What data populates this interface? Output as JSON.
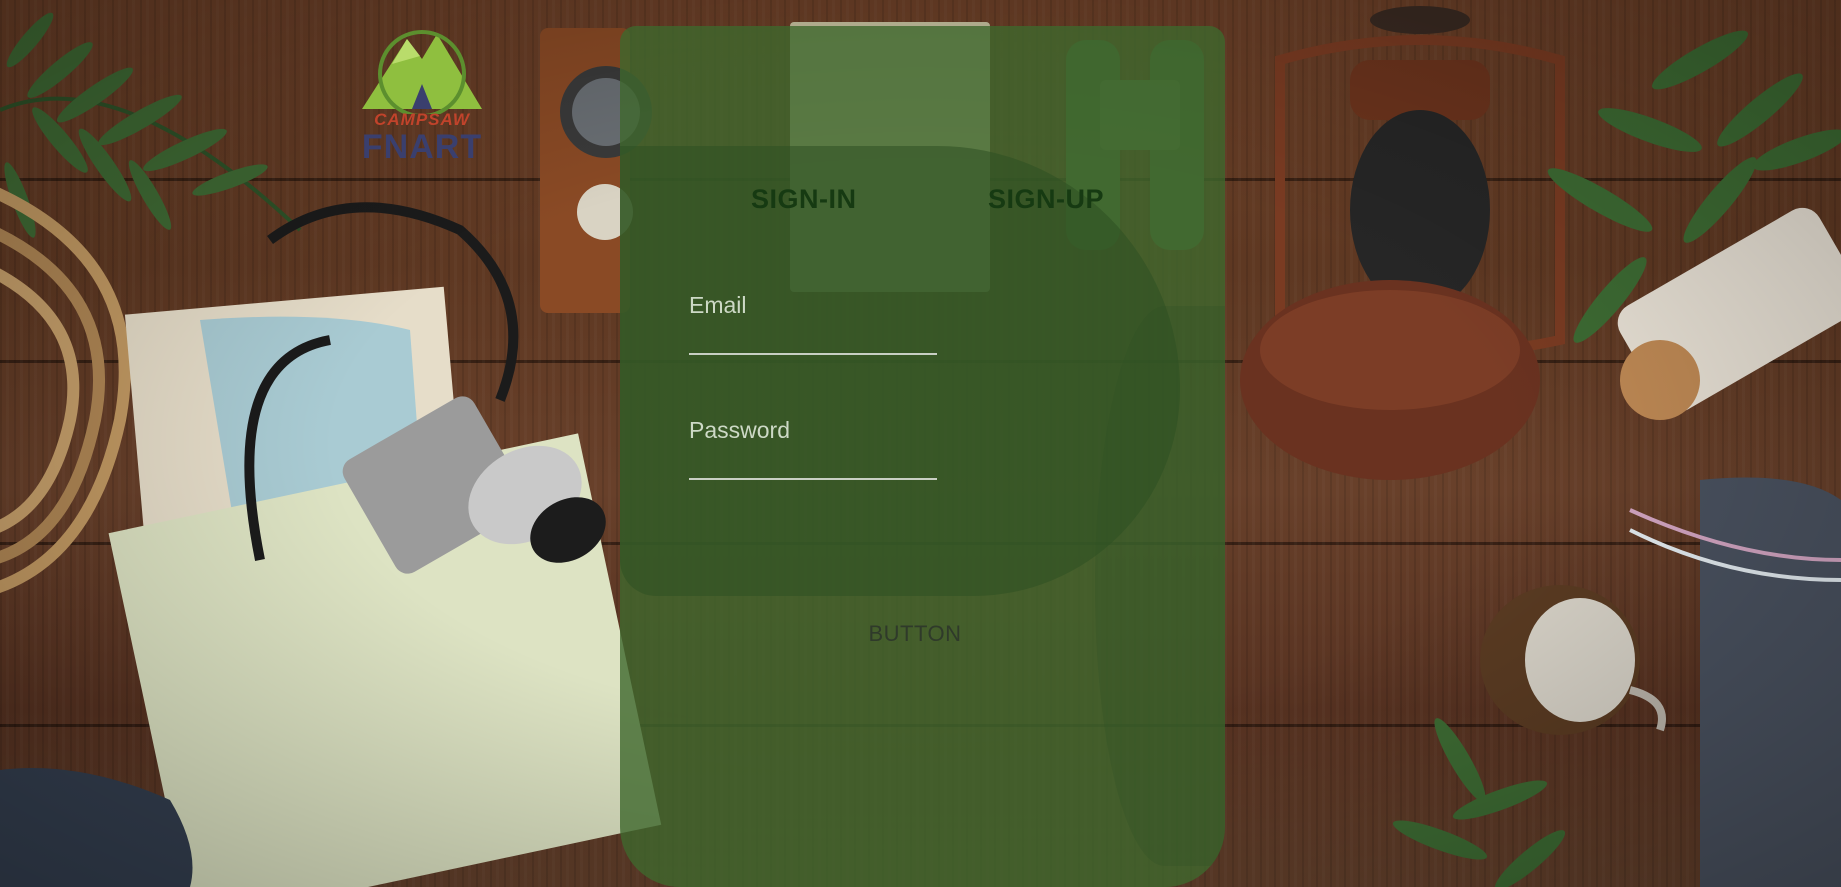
{
  "logo": {
    "line1": "CAMPSAW",
    "line2": "FNART"
  },
  "tabs": {
    "signin": "SIGN-IN",
    "signup": "SIGN-UP"
  },
  "form": {
    "email_label": "Email",
    "password_label": "Password",
    "email_value": "",
    "password_value": "",
    "submit_label": "BUTTON"
  },
  "colors": {
    "panel_green": "#3e682d",
    "tab_text": "#163a12",
    "wood": "#5e3822"
  }
}
